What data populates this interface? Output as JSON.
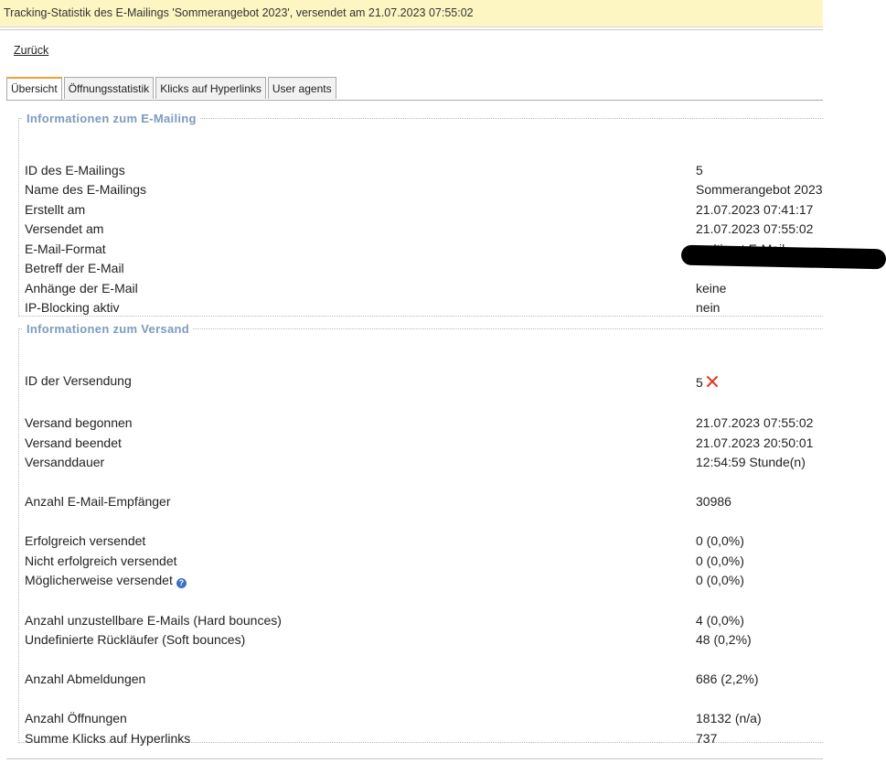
{
  "title": "Tracking-Statistik des E-Mailings 'Sommerangebot 2023', versendet am 21.07.2023 07:55:02",
  "back_label": "Zurück",
  "tabs": [
    {
      "label": "Übersicht",
      "active": true
    },
    {
      "label": "Öffnungsstatistik",
      "active": false
    },
    {
      "label": "Klicks auf Hyperlinks",
      "active": false
    },
    {
      "label": "User agents",
      "active": false
    }
  ],
  "mailing_info": {
    "legend": "Informationen zum E-Mailing",
    "rows": [
      {
        "label": "ID des E-Mailings",
        "value": "5"
      },
      {
        "label": "Name des E-Mailings",
        "value": "Sommerangebot 2023"
      },
      {
        "label": "Erstellt am",
        "value": "21.07.2023 07:41:17"
      },
      {
        "label": "Versendet am",
        "value": "21.07.2023 07:55:02"
      },
      {
        "label": "E-Mail-Format",
        "value": "multipart E-Mail"
      },
      {
        "label": "Betreff der E-Mail",
        "value": ""
      },
      {
        "label": "Anhänge der E-Mail",
        "value": "keine"
      },
      {
        "label": "IP-Blocking aktiv",
        "value": "nein"
      }
    ]
  },
  "send_info": {
    "legend": "Informationen zum Versand",
    "rows": [
      {
        "label": "ID der Versendung",
        "value": "5"
      },
      {
        "label": "Versand begonnen",
        "value": "21.07.2023 07:55:02"
      },
      {
        "label": "Versand beendet",
        "value": "21.07.2023 20:50:01"
      },
      {
        "label": "Versanddauer",
        "value": "12:54:59 Stunde(n)"
      },
      {
        "label": "Anzahl E-Mail-Empfänger",
        "value": "30986"
      },
      {
        "label": "Erfolgreich versendet",
        "value": "0 (0,0%)"
      },
      {
        "label": "Nicht erfolgreich versendet",
        "value": "0 (0,0%)"
      },
      {
        "label": "Möglicherweise versendet",
        "value": "0 (0,0%)"
      },
      {
        "label": "Anzahl unzustellbare E-Mails (Hard bounces)",
        "value": "4 (0,0%)"
      },
      {
        "label": "Undefinierte Rückläufer (Soft bounces)",
        "value": "48 (0,2%)"
      },
      {
        "label": "Anzahl Abmeldungen",
        "value": "686 (2,2%)"
      },
      {
        "label": "Anzahl Öffnungen",
        "value": "18132 (n/a)"
      },
      {
        "label": "Summe Klicks auf Hyperlinks",
        "value": "737"
      }
    ]
  },
  "icons": {
    "help": "help-icon",
    "cancel": "cancel-icon"
  },
  "colors": {
    "title_bg": "#fdf6c3",
    "legend": "#7d9abf",
    "cancel": "#e03a1e",
    "help": "#3c6fc8",
    "active_tab": "#f0a030"
  }
}
